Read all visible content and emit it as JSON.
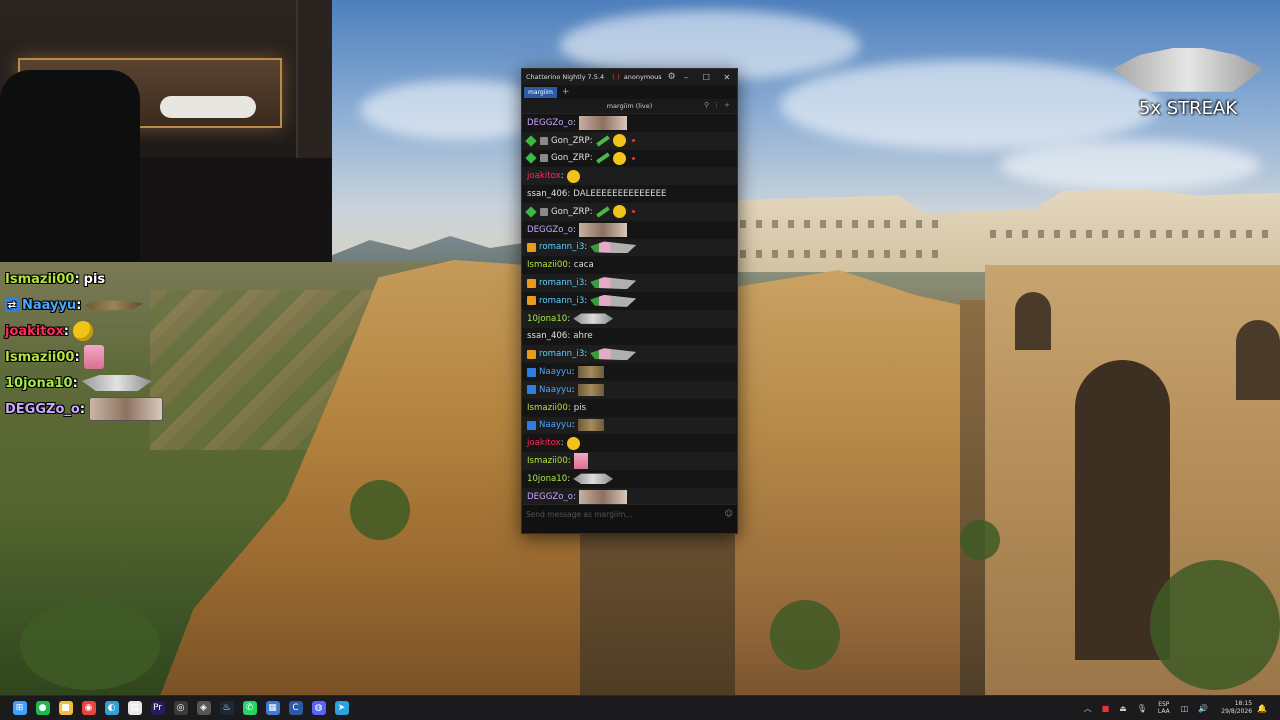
{
  "overlay_chat": [
    {
      "user": "Ismazii00",
      "color": "#b5e33c",
      "badge": false,
      "message": "pis",
      "emote": ""
    },
    {
      "user": "Naayyu",
      "color": "#4aa6ff",
      "badge": true,
      "message": "",
      "emote": "tank"
    },
    {
      "user": "joakitox",
      "color": "#ff2a5a",
      "badge": false,
      "message": "",
      "emote": "smile"
    },
    {
      "user": "Ismazii00",
      "color": "#b5e33c",
      "badge": false,
      "message": "",
      "emote": "pink"
    },
    {
      "user": "10jona10",
      "color": "#a8e64a",
      "badge": false,
      "message": "",
      "emote": "cat"
    },
    {
      "user": "DEGGZo_o",
      "color": "#c8a8ff",
      "badge": false,
      "message": "",
      "emote": "photo"
    }
  ],
  "streak": {
    "text": "5x STREAK"
  },
  "chatterino": {
    "title": "Chatterino Nightly 7.5.4",
    "account": "anonymous",
    "tab": "margiim",
    "split_title": "margiim (live)",
    "input_placeholder": "Send message as margiim...",
    "messages": [
      {
        "user": "DEGGZo_o",
        "color": "#c8a8ff",
        "badges": [],
        "text": "",
        "emotes": [
          "photo"
        ]
      },
      {
        "user": "Gon_ZRP",
        "color": "#e0e0e0",
        "badges": [
          "green",
          "box"
        ],
        "text": "",
        "emotes": [
          "sword",
          "smile",
          "dot"
        ]
      },
      {
        "user": "Gon_ZRP",
        "color": "#e0e0e0",
        "badges": [
          "green",
          "box"
        ],
        "text": "",
        "emotes": [
          "sword",
          "smile",
          "dot"
        ]
      },
      {
        "user": "joakitox",
        "color": "#ff2a5a",
        "badges": [],
        "text": "",
        "emotes": [
          "smile"
        ]
      },
      {
        "user": "ssan_406",
        "color": "#e0e0e0",
        "badges": [],
        "text": "DALEEEEEEEEEEEEEE",
        "emotes": []
      },
      {
        "user": "Gon_ZRP",
        "color": "#e0e0e0",
        "badges": [
          "green",
          "box"
        ],
        "text": "",
        "emotes": [
          "sword",
          "smile",
          "dot"
        ]
      },
      {
        "user": "DEGGZo_o",
        "color": "#c8a8ff",
        "badges": [],
        "text": "",
        "emotes": [
          "photo"
        ]
      },
      {
        "user": "romann_i3",
        "color": "#5ad1ff",
        "badges": [
          "pred"
        ],
        "text": "",
        "emotes": [
          "stack"
        ]
      },
      {
        "user": "Ismazii00",
        "color": "#b5e33c",
        "badges": [],
        "text": "caca",
        "emotes": []
      },
      {
        "user": "romann_i3",
        "color": "#5ad1ff",
        "badges": [
          "pred"
        ],
        "text": "",
        "emotes": [
          "stack"
        ]
      },
      {
        "user": "romann_i3",
        "color": "#5ad1ff",
        "badges": [
          "pred"
        ],
        "text": "",
        "emotes": [
          "stack"
        ]
      },
      {
        "user": "10jona10",
        "color": "#a8e64a",
        "badges": [],
        "text": "",
        "emotes": [
          "cat"
        ]
      },
      {
        "user": "ssan_406",
        "color": "#e0e0e0",
        "badges": [],
        "text": "ahre",
        "emotes": []
      },
      {
        "user": "romann_i3",
        "color": "#5ad1ff",
        "badges": [
          "pred"
        ],
        "text": "",
        "emotes": [
          "stack"
        ]
      },
      {
        "user": "Naayyu",
        "color": "#4aa6ff",
        "badges": [
          "blue"
        ],
        "text": "",
        "emotes": [
          "tank"
        ]
      },
      {
        "user": "Naayyu",
        "color": "#4aa6ff",
        "badges": [
          "blue"
        ],
        "text": "",
        "emotes": [
          "tank"
        ]
      },
      {
        "user": "Ismazii00",
        "color": "#b5e33c",
        "badges": [],
        "text": "pis",
        "emotes": []
      },
      {
        "user": "Naayyu",
        "color": "#4aa6ff",
        "badges": [
          "blue"
        ],
        "text": "",
        "emotes": [
          "tank"
        ]
      },
      {
        "user": "joakitox",
        "color": "#ff2a5a",
        "badges": [],
        "text": "",
        "emotes": [
          "smile"
        ]
      },
      {
        "user": "Ismazii00",
        "color": "#b5e33c",
        "badges": [],
        "text": "",
        "emotes": [
          "pink"
        ]
      },
      {
        "user": "10jona10",
        "color": "#a8e64a",
        "badges": [],
        "text": "",
        "emotes": [
          "cat"
        ]
      },
      {
        "user": "DEGGZo_o",
        "color": "#c8a8ff",
        "badges": [],
        "text": "",
        "emotes": [
          "photo"
        ]
      }
    ]
  },
  "taskbar": {
    "apps": [
      {
        "name": "windows-start-icon",
        "color": "#3ea2ff",
        "glyph": "⊞"
      },
      {
        "name": "spotify-icon",
        "color": "#1db954",
        "glyph": "●"
      },
      {
        "name": "file-explorer-icon",
        "color": "#f0c03a",
        "glyph": "■"
      },
      {
        "name": "chrome-icon",
        "color": "#e8453c",
        "glyph": "◉"
      },
      {
        "name": "edge-icon",
        "color": "#2fa0d8",
        "glyph": "◐"
      },
      {
        "name": "document-icon",
        "color": "#e8e8e8",
        "glyph": "▤"
      },
      {
        "name": "premiere-icon",
        "color": "#2a1a5e",
        "glyph": "Pr"
      },
      {
        "name": "obs-icon",
        "color": "#3a3a3a",
        "glyph": "◎"
      },
      {
        "name": "davinci-icon",
        "color": "#555555",
        "glyph": "◈"
      },
      {
        "name": "steam-icon",
        "color": "#1b2838",
        "glyph": "♨"
      },
      {
        "name": "whatsapp-icon",
        "color": "#25d366",
        "glyph": "✆"
      },
      {
        "name": "notes-icon",
        "color": "#3e7bd6",
        "glyph": "▦"
      },
      {
        "name": "chatterino-icon",
        "color": "#2d5aa8",
        "glyph": "C"
      },
      {
        "name": "discord-icon",
        "color": "#5865f2",
        "glyph": "◍"
      },
      {
        "name": "telegram-icon",
        "color": "#2aa3e0",
        "glyph": "➤"
      }
    ],
    "lang_top": "ESP",
    "lang_bottom": "LAA",
    "time": "18:15",
    "date": "29/8/2026"
  }
}
